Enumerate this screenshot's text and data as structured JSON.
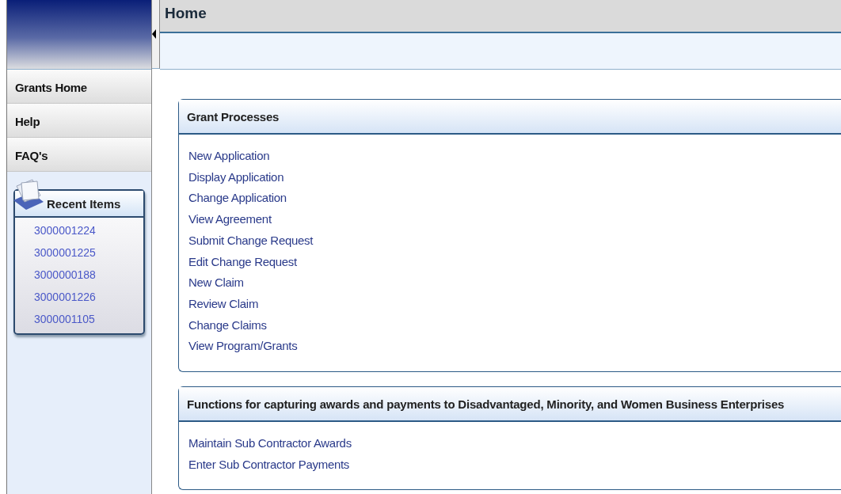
{
  "page": {
    "title": "Home"
  },
  "sidebar": {
    "items": [
      {
        "label": "Grants Home"
      },
      {
        "label": "Help"
      },
      {
        "label": "FAQ's"
      }
    ],
    "recent_items": {
      "title": "Recent Items",
      "items": [
        "3000001224",
        "3000001225",
        "3000000188",
        "3000001226",
        "3000001105"
      ]
    }
  },
  "panels": [
    {
      "title": "Grant Processes",
      "links": [
        "New Application",
        "Display Application",
        "Change Application",
        "View Agreement",
        "Submit Change Request",
        "Edit Change Request",
        "New Claim",
        "Review Claim",
        "Change Claims",
        "View Program/Grants"
      ]
    },
    {
      "title": "Functions for capturing awards and payments to Disadvantaged, Minority, and Women Business Enterprises",
      "links": [
        "Maintain Sub Contractor Awards",
        "Enter Sub Contractor Payments"
      ]
    }
  ]
}
